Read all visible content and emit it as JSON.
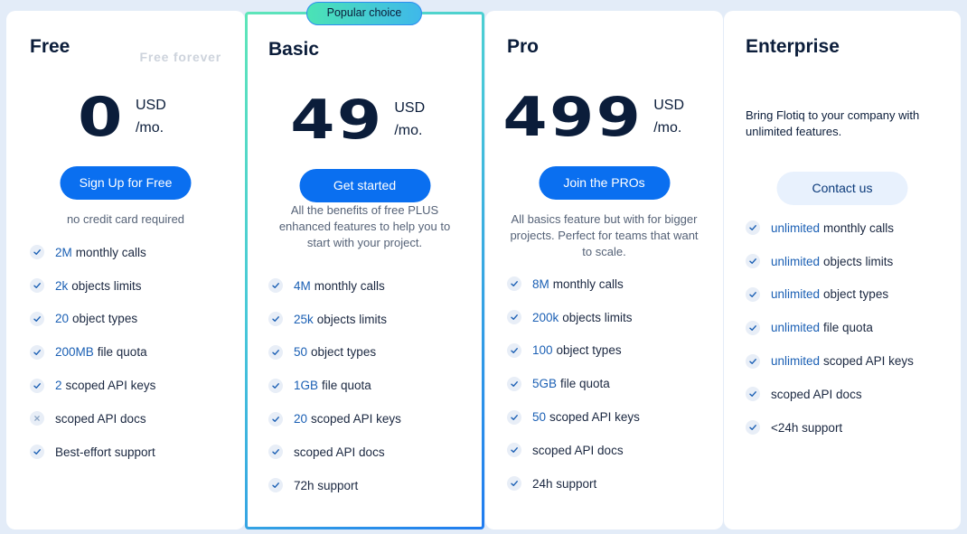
{
  "plans": [
    {
      "id": "free",
      "title": "Free",
      "subtag": "Free forever",
      "price": "0",
      "currency": "USD",
      "period": "/mo.",
      "cta": "Sign Up for Free",
      "note": "no credit card required",
      "features": [
        {
          "highlight": "2M",
          "text": "monthly calls",
          "icon": "check-icon"
        },
        {
          "highlight": "2k",
          "text": "objects limits",
          "icon": "check-icon"
        },
        {
          "highlight": "20",
          "text": "object types",
          "icon": "check-icon"
        },
        {
          "highlight": "200MB",
          "text": "file quota",
          "icon": "check-icon"
        },
        {
          "highlight": "2",
          "text": "scoped API keys",
          "icon": "check-icon"
        },
        {
          "highlight": "",
          "text": "scoped API docs",
          "icon": "cross-icon"
        },
        {
          "highlight": "",
          "text": "Best-effort support",
          "icon": "check-icon"
        }
      ]
    },
    {
      "id": "basic",
      "title": "Basic",
      "badge": "Popular choice",
      "price": "49",
      "currency": "USD",
      "period": "/mo.",
      "cta": "Get started",
      "note": "All the benefits of free PLUS enhanced features to help you to start with your project.",
      "features": [
        {
          "highlight": "4M",
          "text": "monthly calls",
          "icon": "check-icon"
        },
        {
          "highlight": "25k",
          "text": "objects limits",
          "icon": "check-icon"
        },
        {
          "highlight": "50",
          "text": "object types",
          "icon": "check-icon"
        },
        {
          "highlight": "1GB",
          "text": "file quota",
          "icon": "check-icon"
        },
        {
          "highlight": "20",
          "text": "scoped API keys",
          "icon": "check-icon"
        },
        {
          "highlight": "",
          "text": "scoped API docs",
          "icon": "check-icon"
        },
        {
          "highlight": "",
          "text": "72h support",
          "icon": "check-icon"
        }
      ]
    },
    {
      "id": "pro",
      "title": "Pro",
      "price": "499",
      "currency": "USD",
      "period": "/mo.",
      "cta": "Join the PROs",
      "note": "All basics feature but with for bigger projects. Perfect for teams that want to scale.",
      "features": [
        {
          "highlight": "8M",
          "text": "monthly calls",
          "icon": "check-icon"
        },
        {
          "highlight": "200k",
          "text": "objects limits",
          "icon": "check-icon"
        },
        {
          "highlight": "100",
          "text": "object types",
          "icon": "check-icon"
        },
        {
          "highlight": "5GB",
          "text": "file quota",
          "icon": "check-icon"
        },
        {
          "highlight": "50",
          "text": "scoped API keys",
          "icon": "check-icon"
        },
        {
          "highlight": "",
          "text": "scoped API docs",
          "icon": "check-icon"
        },
        {
          "highlight": "",
          "text": "24h support",
          "icon": "check-icon"
        }
      ]
    },
    {
      "id": "enterprise",
      "title": "Enterprise",
      "description": "Bring Flotiq to your company with unlimited features.",
      "cta": "Contact us",
      "features": [
        {
          "highlight": "unlimited",
          "text": "monthly calls",
          "icon": "check-icon"
        },
        {
          "highlight": "unlimited",
          "text": "objects limits",
          "icon": "check-icon"
        },
        {
          "highlight": "unlimited",
          "text": "object types",
          "icon": "check-icon"
        },
        {
          "highlight": "unlimited",
          "text": "file quota",
          "icon": "check-icon"
        },
        {
          "highlight": "unlimited",
          "text": "scoped API keys",
          "icon": "check-icon"
        },
        {
          "highlight": "",
          "text": "scoped API docs",
          "icon": "check-icon"
        },
        {
          "highlight": "",
          "text": "<24h support",
          "icon": "check-icon"
        }
      ]
    }
  ],
  "colors": {
    "primary": "#0a6ff0",
    "highlight_text": "#1a5fb4",
    "heading": "#0b1d3a",
    "background": "#e3ecf8",
    "badge_from": "#4be3b5",
    "badge_to": "#3fb8ea"
  }
}
